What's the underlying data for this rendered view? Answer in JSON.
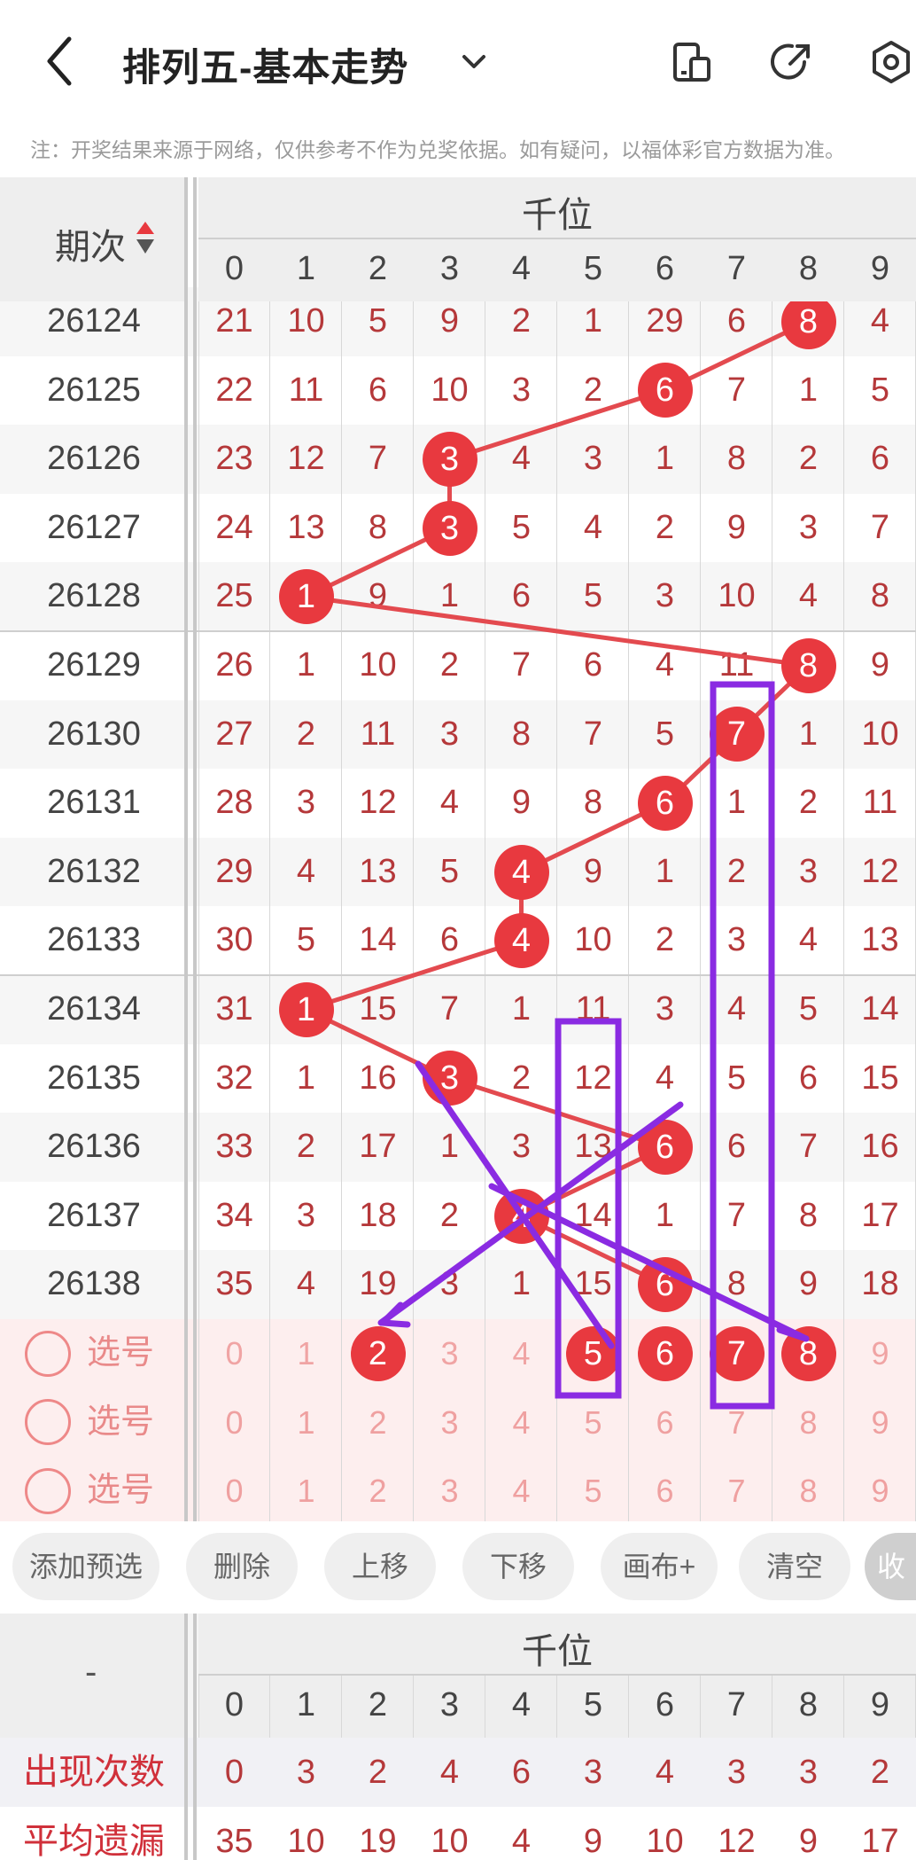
{
  "header": {
    "title": "排列五-基本走势",
    "note": "注：开奖结果来源于网络，仅供参考不作为兑奖依据。如有疑问，以福体彩官方数据为准。"
  },
  "table": {
    "column_group": "千位",
    "issue_header": "期次",
    "digits": [
      "0",
      "1",
      "2",
      "3",
      "4",
      "5",
      "6",
      "7",
      "8",
      "9"
    ],
    "rows": [
      {
        "issue": "26124",
        "cells": [
          "21",
          "10",
          "5",
          "9",
          "2",
          "1",
          "29",
          "6",
          "8",
          "4"
        ],
        "hit": 8
      },
      {
        "issue": "26125",
        "cells": [
          "22",
          "11",
          "6",
          "10",
          "3",
          "2",
          "6",
          "7",
          "1",
          "5"
        ],
        "hit": 6
      },
      {
        "issue": "26126",
        "cells": [
          "23",
          "12",
          "7",
          "3",
          "4",
          "3",
          "1",
          "8",
          "2",
          "6"
        ],
        "hit": 3
      },
      {
        "issue": "26127",
        "cells": [
          "24",
          "13",
          "8",
          "3",
          "5",
          "4",
          "2",
          "9",
          "3",
          "7"
        ],
        "hit": 3
      },
      {
        "issue": "26128",
        "cells": [
          "25",
          "1",
          "9",
          "1",
          "6",
          "5",
          "3",
          "10",
          "4",
          "8"
        ],
        "hit": 1
      },
      {
        "issue": "26129",
        "cells": [
          "26",
          "1",
          "10",
          "2",
          "7",
          "6",
          "4",
          "11",
          "8",
          "9"
        ],
        "hit": 8
      },
      {
        "issue": "26130",
        "cells": [
          "27",
          "2",
          "11",
          "3",
          "8",
          "7",
          "5",
          "7",
          "1",
          "10"
        ],
        "hit": 7
      },
      {
        "issue": "26131",
        "cells": [
          "28",
          "3",
          "12",
          "4",
          "9",
          "8",
          "6",
          "1",
          "2",
          "11"
        ],
        "hit": 6
      },
      {
        "issue": "26132",
        "cells": [
          "29",
          "4",
          "13",
          "5",
          "4",
          "9",
          "1",
          "2",
          "3",
          "12"
        ],
        "hit": 4
      },
      {
        "issue": "26133",
        "cells": [
          "30",
          "5",
          "14",
          "6",
          "4",
          "10",
          "2",
          "3",
          "4",
          "13"
        ],
        "hit": 4
      },
      {
        "issue": "26134",
        "cells": [
          "31",
          "1",
          "15",
          "7",
          "1",
          "11",
          "3",
          "4",
          "5",
          "14"
        ],
        "hit": 1
      },
      {
        "issue": "26135",
        "cells": [
          "32",
          "1",
          "16",
          "3",
          "2",
          "12",
          "4",
          "5",
          "6",
          "15"
        ],
        "hit": 3
      },
      {
        "issue": "26136",
        "cells": [
          "33",
          "2",
          "17",
          "1",
          "3",
          "13",
          "6",
          "6",
          "7",
          "16"
        ],
        "hit": 6
      },
      {
        "issue": "26137",
        "cells": [
          "34",
          "3",
          "18",
          "2",
          "4",
          "14",
          "1",
          "7",
          "8",
          "17"
        ],
        "hit": 4
      },
      {
        "issue": "26138",
        "cells": [
          "35",
          "4",
          "19",
          "3",
          "1",
          "15",
          "6",
          "8",
          "9",
          "18"
        ],
        "hit": 6
      }
    ],
    "select_label": "选号",
    "select_rows": [
      {
        "cells": [
          "0",
          "1",
          "2",
          "3",
          "4",
          "5",
          "6",
          "7",
          "8",
          "9"
        ],
        "picked": [
          2,
          5,
          6,
          7,
          8
        ]
      },
      {
        "cells": [
          "0",
          "1",
          "2",
          "3",
          "4",
          "5",
          "6",
          "7",
          "8",
          "9"
        ],
        "picked": []
      },
      {
        "cells": [
          "0",
          "1",
          "2",
          "3",
          "4",
          "5",
          "6",
          "7",
          "8",
          "9"
        ],
        "picked": []
      }
    ]
  },
  "buttons": [
    "添加预选",
    "删除",
    "上移",
    "下移",
    "画布+",
    "清空",
    "收起"
  ],
  "stats": {
    "left_header": "-",
    "column_group": "千位",
    "digits": [
      "0",
      "1",
      "2",
      "3",
      "4",
      "5",
      "6",
      "7",
      "8",
      "9"
    ],
    "rows": [
      {
        "label": "出现次数",
        "values": [
          "0",
          "3",
          "2",
          "4",
          "6",
          "3",
          "4",
          "3",
          "3",
          "2"
        ]
      },
      {
        "label": "平均遗漏",
        "values": [
          "35",
          "10",
          "19",
          "10",
          "4",
          "9",
          "10",
          "12",
          "9",
          "17"
        ]
      }
    ]
  },
  "colors": {
    "hit_ball": "#e8393f",
    "sort_up": "#e8393f",
    "annotation": "#8a2be2",
    "selection_bg": "#fdeeee"
  }
}
